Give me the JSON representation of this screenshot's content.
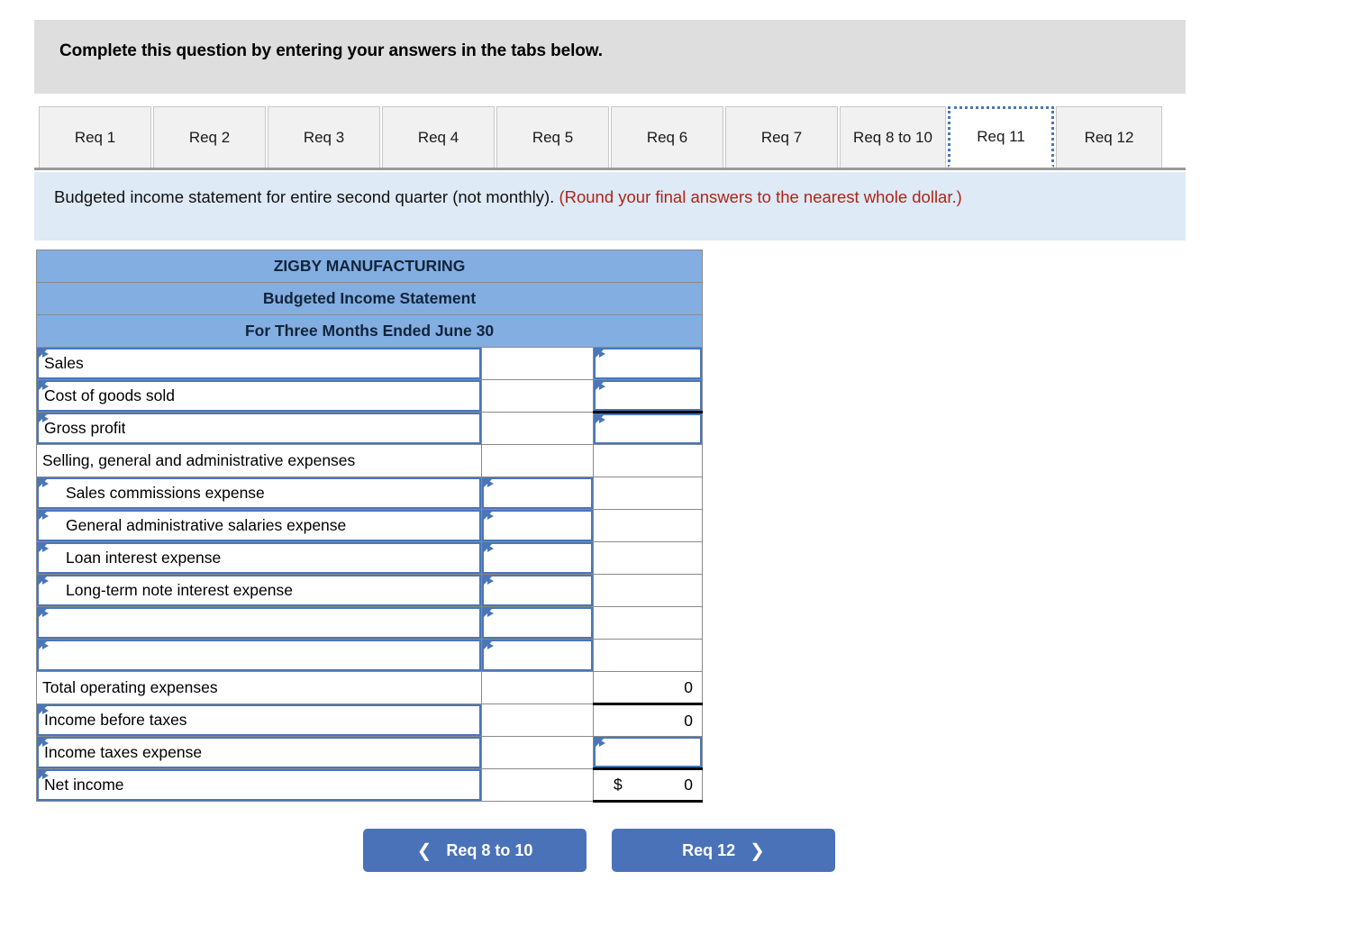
{
  "header": {
    "instruction": "Complete this question by entering your answers in the tabs below."
  },
  "tabs": {
    "items": [
      {
        "label": "Req 1",
        "active": false
      },
      {
        "label": "Req 2",
        "active": false
      },
      {
        "label": "Req 3",
        "active": false
      },
      {
        "label": "Req 4",
        "active": false
      },
      {
        "label": "Req 5",
        "active": false
      },
      {
        "label": "Req 6",
        "active": false
      },
      {
        "label": "Req 7",
        "active": false
      },
      {
        "label": "Req 8 to 10",
        "active": false
      },
      {
        "label": "Req 11",
        "active": true
      },
      {
        "label": "Req 12",
        "active": false
      }
    ]
  },
  "requirement": {
    "text": "Budgeted income statement for entire second quarter (not monthly). ",
    "note": "(Round your final answers to the nearest whole dollar.)"
  },
  "statement": {
    "title_lines": [
      "ZIGBY MANUFACTURING",
      "Budgeted Income Statement",
      "For Three Months Ended June 30"
    ],
    "rows": [
      {
        "label": "Sales",
        "indent": false,
        "label_edit": true,
        "mid": "",
        "mid_edit": false,
        "val": "",
        "val_edit": true,
        "dollar": "",
        "val_rule_top": false,
        "val_rule_bottom": false
      },
      {
        "label": "Cost of goods sold",
        "indent": false,
        "label_edit": true,
        "mid": "",
        "mid_edit": false,
        "val": "",
        "val_edit": true,
        "dollar": "",
        "val_rule_top": false,
        "val_rule_bottom": true
      },
      {
        "label": "Gross profit",
        "indent": false,
        "label_edit": true,
        "mid": "",
        "mid_edit": false,
        "val": "",
        "val_edit": true,
        "dollar": "",
        "val_rule_top": false,
        "val_rule_bottom": false
      },
      {
        "label": "Selling, general and administrative expenses",
        "indent": false,
        "label_edit": false,
        "mid": "",
        "mid_edit": false,
        "val": "",
        "val_edit": false,
        "dollar": "",
        "val_rule_top": false,
        "val_rule_bottom": false
      },
      {
        "label": "Sales commissions expense",
        "indent": true,
        "label_edit": true,
        "mid": "",
        "mid_edit": true,
        "val": "",
        "val_edit": false,
        "dollar": "",
        "val_rule_top": false,
        "val_rule_bottom": false
      },
      {
        "label": "General administrative salaries expense",
        "indent": true,
        "label_edit": true,
        "mid": "",
        "mid_edit": true,
        "val": "",
        "val_edit": false,
        "dollar": "",
        "val_rule_top": false,
        "val_rule_bottom": false
      },
      {
        "label": "Loan interest expense",
        "indent": true,
        "label_edit": true,
        "mid": "",
        "mid_edit": true,
        "val": "",
        "val_edit": false,
        "dollar": "",
        "val_rule_top": false,
        "val_rule_bottom": false
      },
      {
        "label": "Long-term note interest expense",
        "indent": true,
        "label_edit": true,
        "mid": "",
        "mid_edit": true,
        "val": "",
        "val_edit": false,
        "dollar": "",
        "val_rule_top": false,
        "val_rule_bottom": false
      },
      {
        "label": "",
        "indent": false,
        "label_edit": true,
        "mid": "",
        "mid_edit": true,
        "val": "",
        "val_edit": false,
        "dollar": "",
        "val_rule_top": false,
        "val_rule_bottom": false
      },
      {
        "label": "",
        "indent": false,
        "label_edit": true,
        "mid": "",
        "mid_edit": true,
        "val": "",
        "val_edit": false,
        "dollar": "",
        "val_rule_top": false,
        "val_rule_bottom": false
      },
      {
        "label": "Total operating expenses",
        "indent": false,
        "label_edit": false,
        "mid": "",
        "mid_edit": false,
        "val": "0",
        "val_edit": false,
        "dollar": "",
        "val_rule_top": false,
        "val_rule_bottom": false
      },
      {
        "label": "Income before taxes",
        "indent": false,
        "label_edit": true,
        "mid": "",
        "mid_edit": false,
        "val": "0",
        "val_edit": false,
        "dollar": "",
        "val_rule_top": true,
        "val_rule_bottom": false
      },
      {
        "label": "Income taxes expense",
        "indent": false,
        "label_edit": true,
        "mid": "",
        "mid_edit": false,
        "val": "",
        "val_edit": true,
        "dollar": "",
        "val_rule_top": false,
        "val_rule_bottom": false
      },
      {
        "label": "Net income",
        "indent": false,
        "label_edit": true,
        "mid": "",
        "mid_edit": false,
        "val": "0",
        "val_edit": false,
        "dollar": "$",
        "val_rule_top": true,
        "val_rule_bottom": true
      }
    ]
  },
  "nav": {
    "prev_label": "Req 8 to 10",
    "prev_icon": "chevron-left-icon",
    "next_label": "Req 12",
    "next_icon": "chevron-right-icon"
  },
  "colors": {
    "header_gray": "#dedede",
    "banner_blue": "#deeaf6",
    "table_header_blue": "#82aee2",
    "edit_border_blue": "#4a76b8",
    "button_blue": "#4a72b8",
    "note_red": "#b02418"
  }
}
